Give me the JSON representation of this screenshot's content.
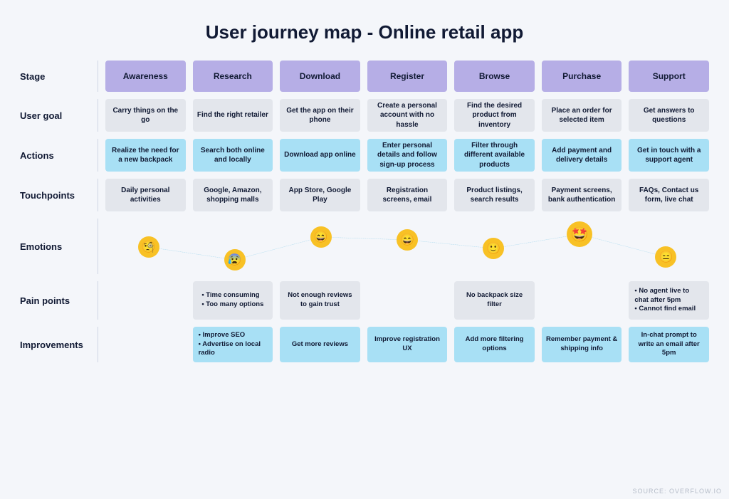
{
  "title": "User journey map - Online retail app",
  "source": "SOURCE: OVERFLOW.IO",
  "rows": {
    "stage": "Stage",
    "goal": "User goal",
    "actions": "Actions",
    "touchpoints": "Touchpoints",
    "emotions": "Emotions",
    "pain": "Pain points",
    "improvements": "Improvements"
  },
  "stages": [
    "Awareness",
    "Research",
    "Download",
    "Register",
    "Browse",
    "Purchase",
    "Support"
  ],
  "goals": [
    "Carry things on the go",
    "Find the right retailer",
    "Get the app on their phone",
    "Create a personal account with no hassle",
    "Find the desired product from inventory",
    "Place an order for selected item",
    "Get answers to questions"
  ],
  "actions": [
    "Realize the need for a new backpack",
    "Search both online and locally",
    "Download app online",
    "Enter personal details and follow sign-up process",
    "Filter through different available products",
    "Add payment and delivery details",
    "Get in touch with a support agent"
  ],
  "touchpoints": [
    "Daily personal activities",
    "Google, Amazon, shopping malls",
    "App Store, Google Play",
    "Registration screens, email",
    "Product listings, search results",
    "Payment screens, bank authentication",
    "FAQs, Contact us form, live chat"
  ],
  "emotions": [
    {
      "name": "monocle-face",
      "y": 40,
      "big": false
    },
    {
      "name": "anxious-sweat",
      "y": 58,
      "big": false
    },
    {
      "name": "grinning-smile",
      "y": 26,
      "big": false
    },
    {
      "name": "grinning-smile",
      "y": 30,
      "big": false
    },
    {
      "name": "smiling-face",
      "y": 42,
      "big": false
    },
    {
      "name": "star-struck",
      "y": 22,
      "big": true
    },
    {
      "name": "unamused-face",
      "y": 54,
      "big": false
    }
  ],
  "pain": [
    null,
    [
      "Time consuming",
      "Too many options"
    ],
    "Not enough reviews to gain trust",
    null,
    "No backpack size filter",
    null,
    [
      "No agent live to chat after 5pm",
      "Cannot find email"
    ]
  ],
  "improvements": [
    null,
    [
      "Improve SEO",
      "Advertise on local radio"
    ],
    "Get more reviews",
    "Improve registration UX",
    "Add more filtering options",
    "Remember payment & shipping info",
    "In-chat prompt to write an email after 5pm"
  ]
}
